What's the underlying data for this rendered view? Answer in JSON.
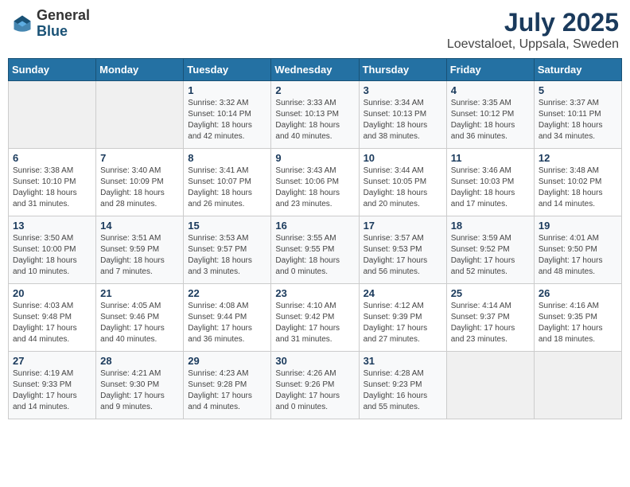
{
  "header": {
    "logo_general": "General",
    "logo_blue": "Blue",
    "title": "July 2025",
    "subtitle": "Loevstaloet, Uppsala, Sweden"
  },
  "calendar": {
    "days_of_week": [
      "Sunday",
      "Monday",
      "Tuesday",
      "Wednesday",
      "Thursday",
      "Friday",
      "Saturday"
    ],
    "weeks": [
      [
        {
          "day": "",
          "info": ""
        },
        {
          "day": "",
          "info": ""
        },
        {
          "day": "1",
          "info": "Sunrise: 3:32 AM\nSunset: 10:14 PM\nDaylight: 18 hours\nand 42 minutes."
        },
        {
          "day": "2",
          "info": "Sunrise: 3:33 AM\nSunset: 10:13 PM\nDaylight: 18 hours\nand 40 minutes."
        },
        {
          "day": "3",
          "info": "Sunrise: 3:34 AM\nSunset: 10:13 PM\nDaylight: 18 hours\nand 38 minutes."
        },
        {
          "day": "4",
          "info": "Sunrise: 3:35 AM\nSunset: 10:12 PM\nDaylight: 18 hours\nand 36 minutes."
        },
        {
          "day": "5",
          "info": "Sunrise: 3:37 AM\nSunset: 10:11 PM\nDaylight: 18 hours\nand 34 minutes."
        }
      ],
      [
        {
          "day": "6",
          "info": "Sunrise: 3:38 AM\nSunset: 10:10 PM\nDaylight: 18 hours\nand 31 minutes."
        },
        {
          "day": "7",
          "info": "Sunrise: 3:40 AM\nSunset: 10:09 PM\nDaylight: 18 hours\nand 28 minutes."
        },
        {
          "day": "8",
          "info": "Sunrise: 3:41 AM\nSunset: 10:07 PM\nDaylight: 18 hours\nand 26 minutes."
        },
        {
          "day": "9",
          "info": "Sunrise: 3:43 AM\nSunset: 10:06 PM\nDaylight: 18 hours\nand 23 minutes."
        },
        {
          "day": "10",
          "info": "Sunrise: 3:44 AM\nSunset: 10:05 PM\nDaylight: 18 hours\nand 20 minutes."
        },
        {
          "day": "11",
          "info": "Sunrise: 3:46 AM\nSunset: 10:03 PM\nDaylight: 18 hours\nand 17 minutes."
        },
        {
          "day": "12",
          "info": "Sunrise: 3:48 AM\nSunset: 10:02 PM\nDaylight: 18 hours\nand 14 minutes."
        }
      ],
      [
        {
          "day": "13",
          "info": "Sunrise: 3:50 AM\nSunset: 10:00 PM\nDaylight: 18 hours\nand 10 minutes."
        },
        {
          "day": "14",
          "info": "Sunrise: 3:51 AM\nSunset: 9:59 PM\nDaylight: 18 hours\nand 7 minutes."
        },
        {
          "day": "15",
          "info": "Sunrise: 3:53 AM\nSunset: 9:57 PM\nDaylight: 18 hours\nand 3 minutes."
        },
        {
          "day": "16",
          "info": "Sunrise: 3:55 AM\nSunset: 9:55 PM\nDaylight: 18 hours\nand 0 minutes."
        },
        {
          "day": "17",
          "info": "Sunrise: 3:57 AM\nSunset: 9:53 PM\nDaylight: 17 hours\nand 56 minutes."
        },
        {
          "day": "18",
          "info": "Sunrise: 3:59 AM\nSunset: 9:52 PM\nDaylight: 17 hours\nand 52 minutes."
        },
        {
          "day": "19",
          "info": "Sunrise: 4:01 AM\nSunset: 9:50 PM\nDaylight: 17 hours\nand 48 minutes."
        }
      ],
      [
        {
          "day": "20",
          "info": "Sunrise: 4:03 AM\nSunset: 9:48 PM\nDaylight: 17 hours\nand 44 minutes."
        },
        {
          "day": "21",
          "info": "Sunrise: 4:05 AM\nSunset: 9:46 PM\nDaylight: 17 hours\nand 40 minutes."
        },
        {
          "day": "22",
          "info": "Sunrise: 4:08 AM\nSunset: 9:44 PM\nDaylight: 17 hours\nand 36 minutes."
        },
        {
          "day": "23",
          "info": "Sunrise: 4:10 AM\nSunset: 9:42 PM\nDaylight: 17 hours\nand 31 minutes."
        },
        {
          "day": "24",
          "info": "Sunrise: 4:12 AM\nSunset: 9:39 PM\nDaylight: 17 hours\nand 27 minutes."
        },
        {
          "day": "25",
          "info": "Sunrise: 4:14 AM\nSunset: 9:37 PM\nDaylight: 17 hours\nand 23 minutes."
        },
        {
          "day": "26",
          "info": "Sunrise: 4:16 AM\nSunset: 9:35 PM\nDaylight: 17 hours\nand 18 minutes."
        }
      ],
      [
        {
          "day": "27",
          "info": "Sunrise: 4:19 AM\nSunset: 9:33 PM\nDaylight: 17 hours\nand 14 minutes."
        },
        {
          "day": "28",
          "info": "Sunrise: 4:21 AM\nSunset: 9:30 PM\nDaylight: 17 hours\nand 9 minutes."
        },
        {
          "day": "29",
          "info": "Sunrise: 4:23 AM\nSunset: 9:28 PM\nDaylight: 17 hours\nand 4 minutes."
        },
        {
          "day": "30",
          "info": "Sunrise: 4:26 AM\nSunset: 9:26 PM\nDaylight: 17 hours\nand 0 minutes."
        },
        {
          "day": "31",
          "info": "Sunrise: 4:28 AM\nSunset: 9:23 PM\nDaylight: 16 hours\nand 55 minutes."
        },
        {
          "day": "",
          "info": ""
        },
        {
          "day": "",
          "info": ""
        }
      ]
    ]
  }
}
